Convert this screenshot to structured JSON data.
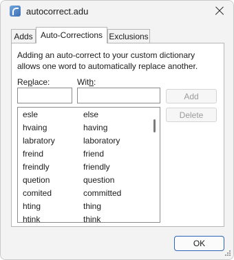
{
  "window": {
    "title": "autocorrect.adu",
    "icon": "app-icon"
  },
  "tabs": [
    {
      "label": "Adds",
      "active": false
    },
    {
      "label": "Auto-Corrections",
      "active": true
    },
    {
      "label": "Exclusions",
      "active": false
    }
  ],
  "panel": {
    "description": "Adding an auto-correct to your custom dictionary allows one word to automatically replace another.",
    "replace_label_prefix": "Re",
    "replace_label_access": "p",
    "replace_label_suffix": "lace:",
    "with_label_prefix": "Wit",
    "with_label_access": "h",
    "with_label_suffix": ":",
    "replace_value": "",
    "with_value": "",
    "add_label": "Add",
    "delete_label": "Delete"
  },
  "corrections": [
    {
      "word": "esle",
      "replacement": "else"
    },
    {
      "word": "hvaing",
      "replacement": "having"
    },
    {
      "word": "labratory",
      "replacement": "laboratory"
    },
    {
      "word": "freind",
      "replacement": "friend"
    },
    {
      "word": "freindly",
      "replacement": "friendly"
    },
    {
      "word": "quetion",
      "replacement": "question"
    },
    {
      "word": "comited",
      "replacement": "committed"
    },
    {
      "word": "hting",
      "replacement": "thing"
    },
    {
      "word": "htink",
      "replacement": "think"
    }
  ],
  "footer": {
    "ok_label": "OK"
  }
}
